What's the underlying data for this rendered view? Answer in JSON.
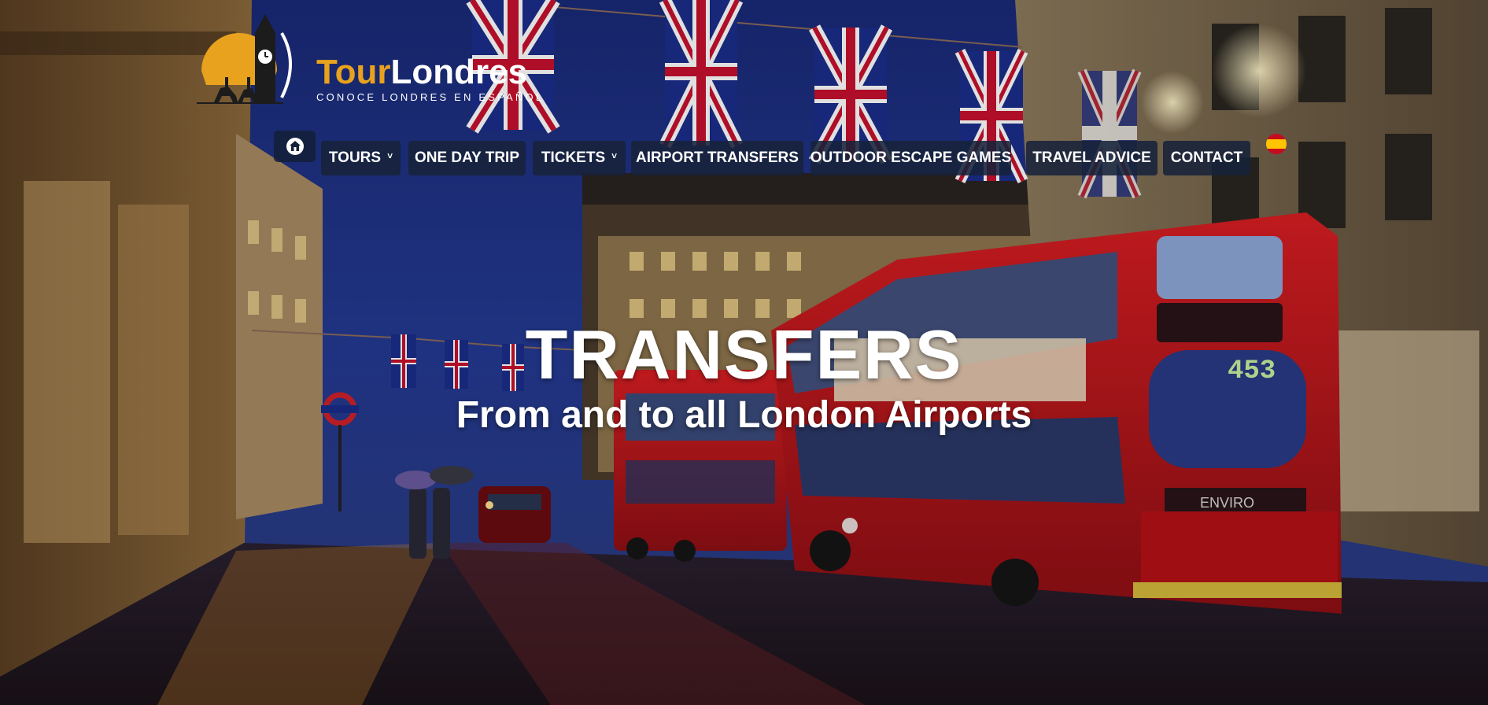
{
  "logo": {
    "brand_part1": "Tour",
    "brand_part2": "Londres",
    "tagline": "CONOCE LONDRES EN ESPAÑOL"
  },
  "nav": {
    "home_icon": "home-icon",
    "items": [
      {
        "label": "TOURS",
        "dropdown": true
      },
      {
        "label": "ONE DAY TRIP",
        "dropdown": false
      },
      {
        "label": "TICKETS",
        "dropdown": true
      },
      {
        "label": "AIRPORT TRANSFERS",
        "dropdown": false
      },
      {
        "label": "OUTDOOR ESCAPE GAMES",
        "dropdown": false
      },
      {
        "label": "TRAVEL ADVICE",
        "dropdown": false
      },
      {
        "label": "CONTACT",
        "dropdown": false
      }
    ],
    "chevron": "˅",
    "language_flag": "spain-flag-icon"
  },
  "hero": {
    "title": "TRANSFERS",
    "subtitle": "From and to all London Airports",
    "bus_number": "453",
    "bus_model": "ENVIRO"
  },
  "colors": {
    "brand_orange": "#e8a21e",
    "nav_bg": "#17223a",
    "bus_red": "#c8161d"
  }
}
